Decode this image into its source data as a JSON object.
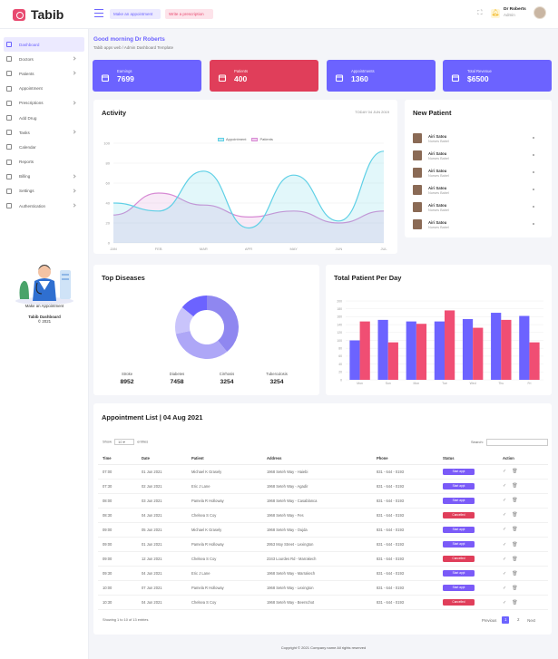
{
  "brand": {
    "name": "Tabib"
  },
  "topbar": {
    "make_appointment": "Make an appointment",
    "write_prescription": "Write a prescription",
    "user_name": "Dr Roberts",
    "user_role": "Admin"
  },
  "sidebar": {
    "items": [
      {
        "label": "Dashboard",
        "icon": "grid-icon",
        "active": true,
        "chevron": false
      },
      {
        "label": "Doctors",
        "icon": "doctor-icon",
        "chevron": true
      },
      {
        "label": "Patients",
        "icon": "users-icon",
        "chevron": true
      },
      {
        "label": "Appointment",
        "icon": "calendar-icon",
        "chevron": false
      },
      {
        "label": "Prescriptions",
        "icon": "clipboard-icon",
        "chevron": true
      },
      {
        "label": "Add Drug",
        "icon": "pill-icon",
        "chevron": false
      },
      {
        "label": "Tasks",
        "icon": "tasks-icon",
        "chevron": true
      },
      {
        "label": "Calendar",
        "icon": "calendar-icon",
        "chevron": false
      },
      {
        "label": "Reports",
        "icon": "report-icon",
        "chevron": false
      },
      {
        "label": "Billing",
        "icon": "billing-icon",
        "chevron": true
      },
      {
        "label": "Settings",
        "icon": "gear-icon",
        "chevron": true
      },
      {
        "label": "Authentication",
        "icon": "lock-icon",
        "chevron": true
      }
    ],
    "promo": "Make an Appointment",
    "footer_title": "Tabib Dashboard",
    "footer_year": "© 2021"
  },
  "greeting": {
    "title": "Good morning Dr Roberts",
    "subtitle": "Tabib apps web / Admin Dashboard Template"
  },
  "stats": [
    {
      "label": "Earnings",
      "value": "7699",
      "color": "#6c63ff",
      "icon": "calendar-icon"
    },
    {
      "label": "Patients",
      "value": "400",
      "color": "#e03e5a",
      "icon": "user-icon"
    },
    {
      "label": "Appointments",
      "value": "1360",
      "color": "#6c63ff",
      "icon": "users-icon"
    },
    {
      "label": "Total Revenue",
      "value": "$6500",
      "color": "#6c63ff",
      "icon": "database-icon"
    }
  ],
  "activity": {
    "title": "Activity",
    "date": "TODAY 04 JUN 2019",
    "legend": [
      "Appointment",
      "Patients"
    ]
  },
  "new_patient": {
    "title": "New Patient",
    "items": [
      {
        "name": "Airi Satou",
        "role": "Nurses Babel"
      },
      {
        "name": "Airi Satou",
        "role": "Nurses Babel"
      },
      {
        "name": "Airi Satou",
        "role": "Nurses Babel"
      },
      {
        "name": "Airi Satou",
        "role": "Nurses Babel"
      },
      {
        "name": "Airi Satou",
        "role": "Nurses Babel"
      },
      {
        "name": "Airi Satou",
        "role": "Nurses Babel"
      }
    ]
  },
  "top_diseases": {
    "title": "Top Diseases",
    "items": [
      {
        "label": "Stroke",
        "value": "8952"
      },
      {
        "label": "Diabetes",
        "value": "7458"
      },
      {
        "label": "Cirrhosis",
        "value": "3254"
      },
      {
        "label": "Tuberculosis",
        "value": "3254"
      }
    ]
  },
  "total_patient": {
    "title": "Total Patient Per Day"
  },
  "chart_data": [
    {
      "type": "area",
      "categories": [
        "JAN",
        "FEB",
        "MAR",
        "APR",
        "MAY",
        "JUN",
        "JUL"
      ],
      "ylim": [
        0,
        100
      ],
      "yticks": [
        0,
        20,
        40,
        60,
        80,
        100
      ],
      "legend": "top-center",
      "grid": true,
      "series": [
        {
          "name": "Appointment",
          "color": "#5fd0e6",
          "values": [
            40,
            32,
            72,
            15,
            68,
            22,
            92
          ]
        },
        {
          "name": "Patients",
          "color": "#d78ad4",
          "values": [
            28,
            50,
            38,
            26,
            32,
            20,
            32
          ]
        }
      ]
    },
    {
      "type": "pie",
      "donut": true,
      "values": [
        8952,
        7458,
        3254,
        3254
      ],
      "colors": [
        "#8f87f0",
        "#aea7f7",
        "#c9c4fb",
        "#6c63ff"
      ]
    },
    {
      "type": "bar",
      "categories": [
        "Mon",
        "Sun",
        "Mon",
        "Tue",
        "Wed",
        "Thu",
        "Fri"
      ],
      "ylim": [
        0,
        200
      ],
      "yticks": [
        0,
        20,
        40,
        60,
        80,
        100,
        120,
        140,
        160,
        180,
        200
      ],
      "grid": true,
      "series": [
        {
          "color": "#6c63ff",
          "values": [
            100,
            152,
            148,
            148,
            154,
            170,
            162
          ]
        },
        {
          "color": "#f04e73",
          "values": [
            148,
            95,
            142,
            176,
            132,
            152,
            95
          ]
        }
      ]
    }
  ],
  "appointments": {
    "title": "Appointment List | 04 Aug 2021",
    "show_label": "Show",
    "show_value": "10",
    "entries_label": "entries",
    "search_label": "Search:",
    "columns": [
      "Time",
      "Date",
      "Patient",
      "Address",
      "Phone",
      "Status",
      "Action"
    ],
    "rows": [
      {
        "time": "07:00",
        "date": "01 Jun 2021",
        "patient": "Michael K Grasely",
        "address": "1968 Seteh Way - Haiebi",
        "phone": "831 - 644 - 0193",
        "status": "Start appt",
        "status_color": "#7a5af8"
      },
      {
        "time": "07:30",
        "date": "02 Jun 2021",
        "patient": "Eric J Lane",
        "address": "1968 Seteh Way - Agadir",
        "phone": "831 - 644 - 0193",
        "status": "Start appt",
        "status_color": "#7a5af8"
      },
      {
        "time": "08:00",
        "date": "03 Jun 2021",
        "patient": "Pamela R Holloway",
        "address": "1968 Seteh Way - Casablanca",
        "phone": "831 - 644 - 0193",
        "status": "Start appt",
        "status_color": "#7a5af8"
      },
      {
        "time": "08:30",
        "date": "04 Jun 2021",
        "patient": "Chelsea S Coy",
        "address": "1968 Seteh Way - Fes",
        "phone": "831 - 644 - 0193",
        "status": "Cancelled",
        "status_color": "#e03e5a"
      },
      {
        "time": "09:00",
        "date": "05 Jun 2021",
        "patient": "Michael K Grasely",
        "address": "1968 Seteh Way - Oujda",
        "phone": "831 - 644 - 0193",
        "status": "Start appt",
        "status_color": "#7a5af8"
      },
      {
        "time": "09:00",
        "date": "01 Jun 2021",
        "patient": "Pamela R Holloway",
        "address": "2953 Moy Street - Lexington",
        "phone": "831 - 644 - 0193",
        "status": "Start appt",
        "status_color": "#7a5af8"
      },
      {
        "time": "09:00",
        "date": "12 Jun 2021",
        "patient": "Chelsea S Coy",
        "address": "2343 Lourdes Rd - Marrakech",
        "phone": "831 - 644 - 0193",
        "status": "Cancelled",
        "status_color": "#e03e5a"
      },
      {
        "time": "09:30",
        "date": "04 Jun 2021",
        "patient": "Eric J Lane",
        "address": "1968 Seteh Way - Marrakech",
        "phone": "831 - 644 - 0193",
        "status": "Start appt",
        "status_color": "#7a5af8"
      },
      {
        "time": "10:00",
        "date": "07 Jun 2021",
        "patient": "Pamela R Holloway",
        "address": "1968 Seteh Way - Lexington",
        "phone": "831 - 644 - 0193",
        "status": "Start appt",
        "status_color": "#7a5af8"
      },
      {
        "time": "10:30",
        "date": "04 Jun 2021",
        "patient": "Chelsea S Coy",
        "address": "1968 Seteh Way - Beerschot",
        "phone": "831 - 644 - 0193",
        "status": "Cancelled",
        "status_color": "#e03e5a"
      }
    ],
    "footer": "Showing 1 to 10 of 13 entries",
    "prev": "Previous",
    "pages": [
      "1",
      "2"
    ],
    "next": "Next"
  },
  "copyright": "Copyright © 2021 Company name All rights reserved"
}
